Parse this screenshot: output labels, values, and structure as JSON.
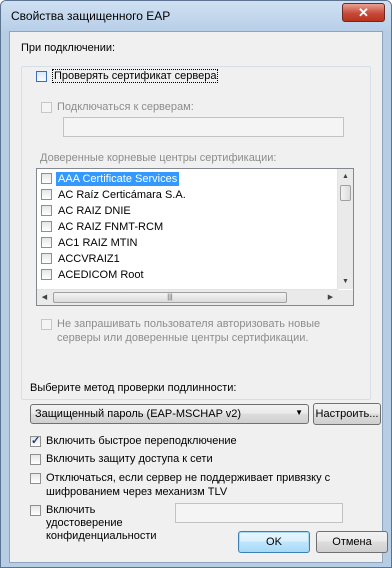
{
  "window": {
    "title": "Свойства защищенного EAP",
    "close_glyph": "✕"
  },
  "connect_section": {
    "heading": "При подключении:",
    "verify_cert": {
      "label": "Проверять сертификат сервера",
      "checked": false
    },
    "connect_servers": {
      "label": "Подключаться к серверам:",
      "checked": false,
      "value": ""
    },
    "trusted_ca_label": "Доверенные корневые центры сертификации:",
    "ca_list": [
      {
        "label": "AAA Certificate Services",
        "selected": true
      },
      {
        "label": "AC Raíz Certicámara S.A.",
        "selected": false
      },
      {
        "label": "AC RAIZ DNIE",
        "selected": false
      },
      {
        "label": "AC RAIZ FNMT-RCM",
        "selected": false
      },
      {
        "label": "AC1 RAIZ MTIN",
        "selected": false
      },
      {
        "label": "ACCVRAIZ1",
        "selected": false
      },
      {
        "label": "ACEDICOM Root",
        "selected": false
      }
    ],
    "no_prompt": {
      "line1": "Не запрашивать пользователя авторизовать новые",
      "line2": "серверы или доверенные центры сертификации.",
      "checked": false
    }
  },
  "auth_method": {
    "label": "Выберите метод проверки подлинности:",
    "selected": "Защищенный пароль (EAP-MSCHAP v2)",
    "configure_label": "Настроить..."
  },
  "options": {
    "fast_reconnect": {
      "label": "Включить быстрое переподключение",
      "checked": true
    },
    "nap": {
      "label": "Включить защиту доступа к сети",
      "checked": false
    },
    "disconnect": {
      "line1": "Отключаться, если сервер не поддерживает привязку с",
      "line2": "шифрованием через механизм TLV",
      "checked": false
    },
    "identity_privacy": {
      "line1": "Включить",
      "line2": "удостоверение",
      "line3": "конфиденциальности",
      "checked": false,
      "value": ""
    }
  },
  "buttons": {
    "ok": "OK",
    "cancel": "Отмена"
  },
  "colors": {
    "selection": "#3399ff",
    "window_frame": "#b7cde4",
    "dialog_bg": "#f0f0f0"
  }
}
